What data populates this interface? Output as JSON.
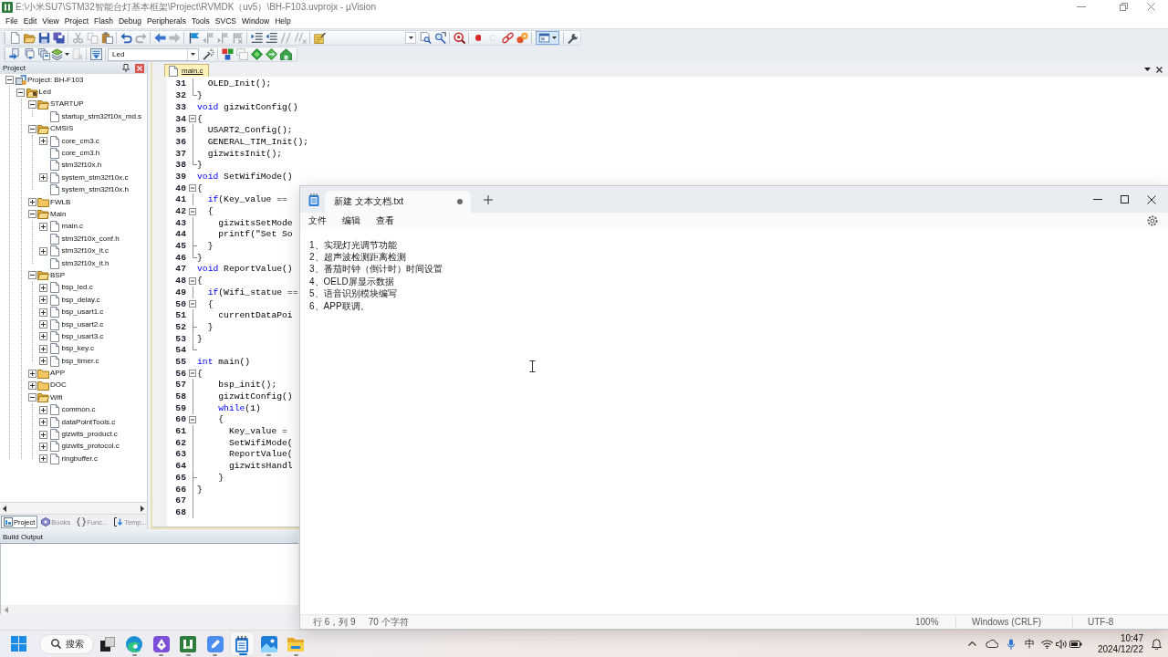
{
  "ide_window": {
    "title": "E:\\小米SU7\\STM32智能台灯基本框架\\Project\\RVMDK（uv5）\\BH-F103.uvprojx - µVision"
  },
  "menu": [
    "File",
    "Edit",
    "View",
    "Project",
    "Flash",
    "Debug",
    "Peripherals",
    "Tools",
    "SVCS",
    "Window",
    "Help"
  ],
  "file_toolbar": {
    "groups": [
      [
        {
          "kind": "new-file",
          "disabled": false,
          "pressed": false
        },
        {
          "kind": "open",
          "disabled": false,
          "pressed": false
        },
        {
          "kind": "save",
          "disabled": false,
          "pressed": false
        },
        {
          "kind": "save-all",
          "disabled": false,
          "pressed": false
        }
      ],
      [
        {
          "kind": "cut",
          "disabled": true,
          "pressed": false
        },
        {
          "kind": "copy",
          "disabled": true,
          "pressed": false
        },
        {
          "kind": "paste",
          "disabled": false,
          "pressed": false
        }
      ],
      [
        {
          "kind": "undo",
          "disabled": false,
          "pressed": false
        },
        {
          "kind": "redo",
          "disabled": true,
          "pressed": false
        }
      ],
      [
        {
          "kind": "back",
          "disabled": false,
          "pressed": false
        },
        {
          "kind": "forward",
          "disabled": true,
          "pressed": false
        }
      ],
      [
        {
          "kind": "bookmark",
          "disabled": false,
          "pressed": false
        },
        {
          "kind": "bookmark-prev",
          "disabled": true,
          "pressed": false
        },
        {
          "kind": "bookmark-next",
          "disabled": true,
          "pressed": false
        },
        {
          "kind": "bookmark-clear",
          "disabled": true,
          "pressed": false
        }
      ],
      [
        {
          "kind": "indent",
          "disabled": false,
          "pressed": false
        },
        {
          "kind": "unindent",
          "disabled": false,
          "pressed": false
        },
        {
          "kind": "comment",
          "disabled": true,
          "pressed": false
        },
        {
          "kind": "uncomment",
          "disabled": true,
          "pressed": false
        }
      ],
      [
        {
          "kind": "find-in-files",
          "disabled": false,
          "pressed": false
        }
      ],
      [
        {
          "kind": "find-combo",
          "disabled": false,
          "pressed": false
        },
        {
          "kind": "find",
          "disabled": false,
          "pressed": false
        },
        {
          "kind": "incremental-find",
          "disabled": false,
          "pressed": false
        }
      ],
      [
        {
          "kind": "debug",
          "disabled": false,
          "pressed": false
        }
      ],
      [
        {
          "kind": "breakpoint",
          "disabled": false,
          "pressed": false
        },
        {
          "kind": "breakpoint-toggle",
          "disabled": true,
          "pressed": false
        },
        {
          "kind": "breakpoint-kill",
          "disabled": false,
          "pressed": false
        },
        {
          "kind": "breakpoints-window",
          "disabled": false,
          "pressed": false
        }
      ],
      [
        {
          "kind": "window-layout",
          "disabled": false,
          "pressed": true
        }
      ],
      [
        {
          "kind": "configure",
          "disabled": false,
          "pressed": false
        }
      ]
    ]
  },
  "build_toolbar": {
    "groups": [
      [
        {
          "kind": "translate",
          "disabled": false
        },
        {
          "kind": "build",
          "disabled": false
        },
        {
          "kind": "rebuild",
          "disabled": false
        },
        {
          "kind": "batch-build",
          "disabled": false
        },
        {
          "kind": "stop-build",
          "disabled": true
        }
      ],
      [
        {
          "kind": "download",
          "disabled": false
        }
      ],
      [
        {
          "kind": "target-select",
          "value": "Led"
        },
        {
          "kind": "target-options",
          "disabled": false
        }
      ],
      [
        {
          "kind": "manage-components",
          "disabled": false
        },
        {
          "kind": "select-packs",
          "disabled": true
        },
        {
          "kind": "run-time-environment",
          "disabled": false
        },
        {
          "kind": "pack-installer",
          "disabled": false
        },
        {
          "kind": "pack-manager",
          "disabled": false
        }
      ]
    ]
  },
  "project_panel": {
    "title": "Project",
    "tree": [
      {
        "label": "Project: BH-F103",
        "kind": "project",
        "expanded": true,
        "children": [
          {
            "label": "Led",
            "kind": "target",
            "expanded": true,
            "children": [
              {
                "label": "STARTUP",
                "kind": "folder",
                "expanded": true,
                "children": [
                  {
                    "label": "startup_stm32f10x_md.s",
                    "kind": "file"
                  }
                ]
              },
              {
                "label": "CMSIS",
                "kind": "folder",
                "expanded": true,
                "children": [
                  {
                    "label": "core_cm3.c",
                    "kind": "file",
                    "expanded": false
                  },
                  {
                    "label": "core_cm3.h",
                    "kind": "file"
                  },
                  {
                    "label": "stm32f10x.h",
                    "kind": "file"
                  },
                  {
                    "label": "system_stm32f10x.c",
                    "kind": "file",
                    "expanded": false
                  },
                  {
                    "label": "system_stm32f10x.h",
                    "kind": "file"
                  }
                ]
              },
              {
                "label": "FWLB",
                "kind": "folder",
                "expanded": false
              },
              {
                "label": "Main",
                "kind": "folder",
                "expanded": true,
                "children": [
                  {
                    "label": "main.c",
                    "kind": "file",
                    "expanded": false
                  },
                  {
                    "label": "stm32f10x_conf.h",
                    "kind": "file"
                  },
                  {
                    "label": "stm32f10x_it.c",
                    "kind": "file",
                    "expanded": false
                  },
                  {
                    "label": "stm32f10x_it.h",
                    "kind": "file"
                  }
                ]
              },
              {
                "label": "BSP",
                "kind": "folder",
                "expanded": true,
                "children": [
                  {
                    "label": "bsp_led.c",
                    "kind": "file",
                    "expanded": false
                  },
                  {
                    "label": "bsp_delay.c",
                    "kind": "file",
                    "expanded": false
                  },
                  {
                    "label": "bsp_usart1.c",
                    "kind": "file",
                    "expanded": false
                  },
                  {
                    "label": "bsp_usart2.c",
                    "kind": "file",
                    "expanded": false
                  },
                  {
                    "label": "bsp_usart3.c",
                    "kind": "file",
                    "expanded": false
                  },
                  {
                    "label": "bsp_key.c",
                    "kind": "file",
                    "expanded": false
                  },
                  {
                    "label": "bsp_timer.c",
                    "kind": "file",
                    "expanded": false
                  }
                ]
              },
              {
                "label": "APP",
                "kind": "folder",
                "expanded": false
              },
              {
                "label": "DOC",
                "kind": "folder",
                "expanded": false
              },
              {
                "label": "Wifi",
                "kind": "folder",
                "expanded": true,
                "children": [
                  {
                    "label": "common.c",
                    "kind": "file",
                    "expanded": false
                  },
                  {
                    "label": "dataPointTools.c",
                    "kind": "file",
                    "expanded": false
                  },
                  {
                    "label": "gizwits_product.c",
                    "kind": "file",
                    "expanded": false
                  },
                  {
                    "label": "gizwits_protocol.c",
                    "kind": "file",
                    "expanded": false
                  },
                  {
                    "label": "ringbuffer.c",
                    "kind": "file",
                    "expanded": false
                  }
                ]
              }
            ]
          }
        ]
      }
    ],
    "tabs": [
      {
        "label": "Project",
        "kind": "project",
        "selected": true
      },
      {
        "label": "Books",
        "kind": "books",
        "selected": false
      },
      {
        "label": "Func...",
        "kind": "functions",
        "selected": false
      },
      {
        "label": "Temp...",
        "kind": "templates",
        "selected": false
      }
    ]
  },
  "editor": {
    "tabs": [
      {
        "label": "main.c",
        "selected": true
      }
    ],
    "lines": [
      {
        "number": "31",
        "fold": {
          "kind": "line"
        },
        "code": [
          {
            "kind": "plain",
            "text": "  OLED_Init();"
          }
        ]
      },
      {
        "number": "32",
        "fold": {
          "kind": "end"
        },
        "code": [
          {
            "kind": "plain",
            "text": "}"
          }
        ]
      },
      {
        "number": "33",
        "code": [
          {
            "kind": "keyword",
            "text": "void"
          },
          {
            "kind": "plain",
            "text": " gizwitConfig()"
          }
        ]
      },
      {
        "number": "34",
        "fold": {
          "kind": "open"
        },
        "code": [
          {
            "kind": "plain",
            "text": "{"
          }
        ]
      },
      {
        "number": "35",
        "fold": {
          "kind": "line"
        },
        "code": [
          {
            "kind": "plain",
            "text": "  USART2_Config();"
          }
        ]
      },
      {
        "number": "36",
        "fold": {
          "kind": "line"
        },
        "code": [
          {
            "kind": "plain",
            "text": "  GENERAL_TIM_Init();"
          }
        ]
      },
      {
        "number": "37",
        "fold": {
          "kind": "line"
        },
        "code": [
          {
            "kind": "plain",
            "text": "  gizwitsInit();"
          }
        ]
      },
      {
        "number": "38",
        "fold": {
          "kind": "end"
        },
        "code": [
          {
            "kind": "plain",
            "text": "}"
          }
        ]
      },
      {
        "number": "39",
        "code": [
          {
            "kind": "keyword",
            "text": "void"
          },
          {
            "kind": "plain",
            "text": " SetWifiMode()"
          }
        ]
      },
      {
        "number": "40",
        "fold": {
          "kind": "open"
        },
        "code": [
          {
            "kind": "plain",
            "text": "{"
          }
        ]
      },
      {
        "number": "41",
        "fold": {
          "kind": "line"
        },
        "code": [
          {
            "kind": "keyword",
            "text": "  if"
          },
          {
            "kind": "plain",
            "text": "(Key_value =="
          }
        ]
      },
      {
        "number": "42",
        "fold": {
          "kind": "open"
        },
        "code": [
          {
            "kind": "plain",
            "text": "  {"
          }
        ]
      },
      {
        "number": "43",
        "fold": {
          "kind": "line"
        },
        "code": [
          {
            "kind": "plain",
            "text": "    gizwitsSetMode"
          }
        ]
      },
      {
        "number": "44",
        "fold": {
          "kind": "line"
        },
        "code": [
          {
            "kind": "plain",
            "text": "    printf(\"Set So"
          }
        ]
      },
      {
        "number": "45",
        "fold": {
          "kind": "tick"
        },
        "code": [
          {
            "kind": "plain",
            "text": "  }"
          }
        ]
      },
      {
        "number": "46",
        "fold": {
          "kind": "end"
        },
        "code": [
          {
            "kind": "plain",
            "text": "}"
          }
        ]
      },
      {
        "number": "47",
        "code": [
          {
            "kind": "keyword",
            "text": "void"
          },
          {
            "kind": "plain",
            "text": " ReportValue()"
          }
        ]
      },
      {
        "number": "48",
        "fold": {
          "kind": "open"
        },
        "code": [
          {
            "kind": "plain",
            "text": "{"
          }
        ]
      },
      {
        "number": "49",
        "fold": {
          "kind": "line"
        },
        "code": [
          {
            "kind": "keyword",
            "text": "  if"
          },
          {
            "kind": "plain",
            "text": "(Wifi_statue =="
          }
        ]
      },
      {
        "number": "50",
        "fold": {
          "kind": "open"
        },
        "code": [
          {
            "kind": "plain",
            "text": "  {"
          }
        ]
      },
      {
        "number": "51",
        "fold": {
          "kind": "line"
        },
        "code": [
          {
            "kind": "plain",
            "text": "    currentDataPoi"
          }
        ]
      },
      {
        "number": "52",
        "fold": {
          "kind": "tick"
        },
        "code": [
          {
            "kind": "plain",
            "text": "  }"
          }
        ]
      },
      {
        "number": "53",
        "fold": {
          "kind": "line"
        },
        "code": [
          {
            "kind": "plain",
            "text": "}"
          }
        ]
      },
      {
        "number": "54",
        "fold": {
          "kind": "end"
        }
      },
      {
        "number": "55",
        "code": [
          {
            "kind": "keyword",
            "text": "int"
          },
          {
            "kind": "plain",
            "text": " main()"
          }
        ]
      },
      {
        "number": "56",
        "fold": {
          "kind": "open"
        },
        "code": [
          {
            "kind": "plain",
            "text": "{"
          }
        ]
      },
      {
        "number": "57",
        "fold": {
          "kind": "line"
        },
        "code": [
          {
            "kind": "plain",
            "text": "    bsp_init();"
          }
        ]
      },
      {
        "number": "58",
        "fold": {
          "kind": "line"
        },
        "code": [
          {
            "kind": "plain",
            "text": "    gizwitConfig()"
          }
        ]
      },
      {
        "number": "59",
        "fold": {
          "kind": "line"
        },
        "code": [
          {
            "kind": "keyword",
            "text": "    while"
          },
          {
            "kind": "plain",
            "text": "(1)"
          }
        ]
      },
      {
        "number": "60",
        "fold": {
          "kind": "open"
        },
        "code": [
          {
            "kind": "plain",
            "text": "    {"
          }
        ]
      },
      {
        "number": "61",
        "fold": {
          "kind": "line"
        },
        "code": [
          {
            "kind": "plain",
            "text": "      Key_value ="
          }
        ]
      },
      {
        "number": "62",
        "fold": {
          "kind": "line"
        },
        "code": [
          {
            "kind": "plain",
            "text": "      SetWifiMode("
          }
        ]
      },
      {
        "number": "63",
        "fold": {
          "kind": "line"
        },
        "code": [
          {
            "kind": "plain",
            "text": "      ReportValue("
          }
        ]
      },
      {
        "number": "64",
        "fold": {
          "kind": "line"
        },
        "code": [
          {
            "kind": "plain",
            "text": "      gizwitsHandl"
          }
        ]
      },
      {
        "number": "65",
        "fold": {
          "kind": "tick"
        },
        "code": [
          {
            "kind": "plain",
            "text": "    }"
          }
        ]
      },
      {
        "number": "66",
        "fold": {
          "kind": "line"
        },
        "code": [
          {
            "kind": "plain",
            "text": "}"
          }
        ]
      },
      {
        "number": "67",
        "fold": {
          "kind": "line"
        }
      },
      {
        "number": "68",
        "fold": {
          "kind": "line"
        }
      }
    ]
  },
  "build_output": {
    "title": "Build Output"
  },
  "notepad": {
    "tabs": [
      {
        "label": "新建 文本文档.txt",
        "selected": true,
        "unsaved": true
      }
    ],
    "menu": [
      "文件",
      "编辑",
      "查看"
    ],
    "text_lines": [
      "1、实现灯光调节功能",
      "2、超声波检测距离检测",
      "3、番茄时钟（倒计时）时间设置",
      "4、OELD屏显示数据",
      "5、语音识别模块编写",
      "6、APP联调。"
    ],
    "status": {
      "position": "行 6，列 9",
      "characters": "70 个字符",
      "zoom": "100%",
      "line_ending": "Windows (CRLF)",
      "encoding": "UTF-8"
    }
  },
  "taskbar": {
    "search": {
      "placeholder": "搜索"
    },
    "apps": [
      {
        "kind": "task-view",
        "running": false,
        "selected": false
      },
      {
        "kind": "browser",
        "running": true,
        "selected": false
      },
      {
        "kind": "pen",
        "running": true,
        "selected": false
      },
      {
        "kind": "ide",
        "running": true,
        "selected": false
      },
      {
        "kind": "pencil",
        "running": true,
        "selected": false
      },
      {
        "kind": "notepad",
        "running": true,
        "selected": true
      },
      {
        "kind": "photos",
        "running": true,
        "selected": false
      },
      {
        "kind": "files",
        "running": true,
        "selected": false
      }
    ],
    "tray": {
      "input_method": "中"
    },
    "clock": {
      "time": "10:47",
      "date": "2024/12/22"
    }
  }
}
